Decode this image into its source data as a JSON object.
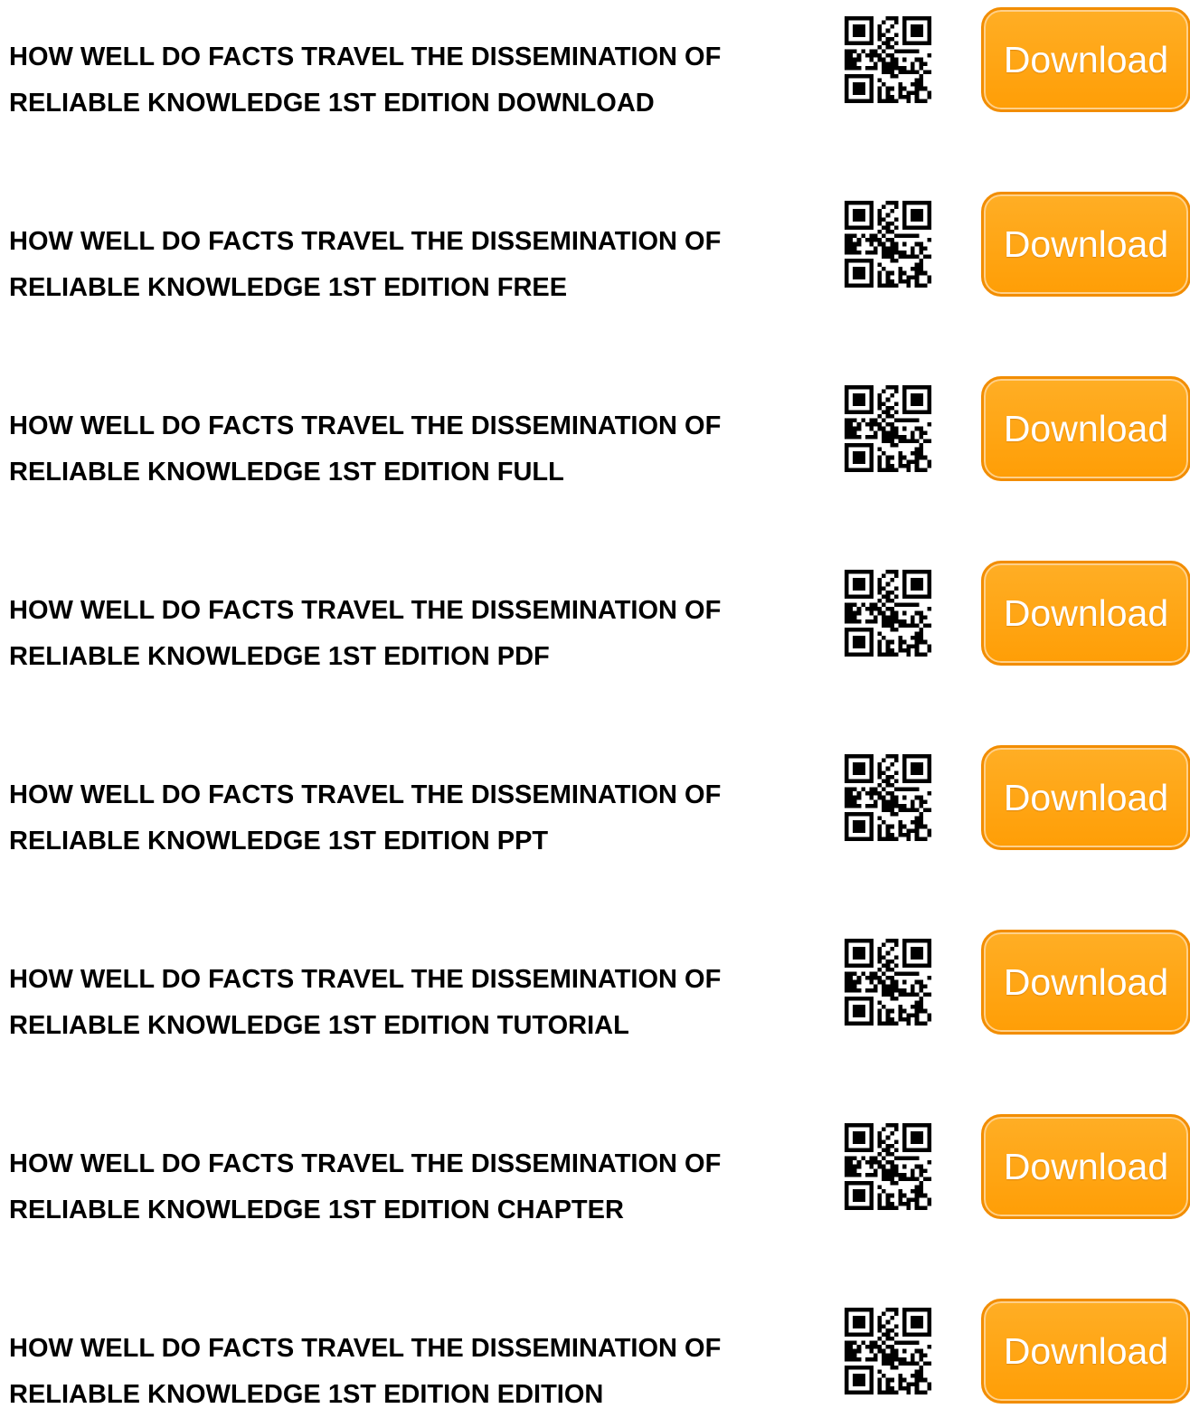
{
  "items": [
    {
      "title_line1": "HOW WELL DO FACTS TRAVEL THE DISSEMINATION OF",
      "title_line2": "RELIABLE KNOWLEDGE 1ST EDITION DOWNLOAD",
      "button_label": "Download"
    },
    {
      "title_line1": "HOW WELL DO FACTS TRAVEL THE DISSEMINATION OF",
      "title_line2": "RELIABLE KNOWLEDGE 1ST EDITION FREE",
      "button_label": "Download"
    },
    {
      "title_line1": "HOW WELL DO FACTS TRAVEL THE DISSEMINATION OF",
      "title_line2": "RELIABLE KNOWLEDGE 1ST EDITION FULL",
      "button_label": "Download"
    },
    {
      "title_line1": "HOW WELL DO FACTS TRAVEL THE DISSEMINATION OF",
      "title_line2": "RELIABLE KNOWLEDGE 1ST EDITION PDF",
      "button_label": "Download"
    },
    {
      "title_line1": "HOW WELL DO FACTS TRAVEL THE DISSEMINATION OF",
      "title_line2": "RELIABLE KNOWLEDGE 1ST EDITION PPT",
      "button_label": "Download"
    },
    {
      "title_line1": "HOW WELL DO FACTS TRAVEL THE DISSEMINATION OF",
      "title_line2": "RELIABLE KNOWLEDGE 1ST EDITION TUTORIAL",
      "button_label": "Download"
    },
    {
      "title_line1": "HOW WELL DO FACTS TRAVEL THE DISSEMINATION OF",
      "title_line2": "RELIABLE KNOWLEDGE 1ST EDITION CHAPTER",
      "button_label": "Download"
    },
    {
      "title_line1": "HOW WELL DO FACTS TRAVEL THE DISSEMINATION OF",
      "title_line2": "RELIABLE KNOWLEDGE 1ST EDITION EDITION",
      "button_label": "Download"
    }
  ],
  "qr_icon": "qr-code-icon",
  "colors": {
    "button_fill": "#ff9e06",
    "button_border": "#f28d00",
    "button_text": "#ffffff",
    "title_text": "#000000"
  }
}
